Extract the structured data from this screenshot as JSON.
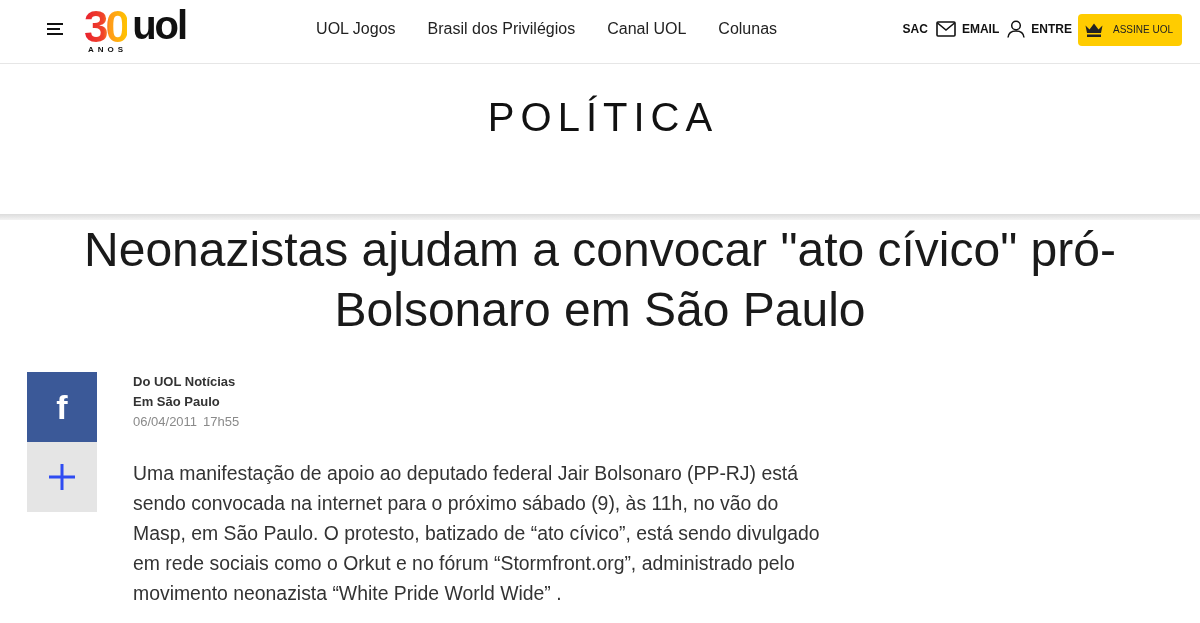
{
  "header": {
    "logo": {
      "number": "30",
      "wordmark": "uol",
      "caption": "ANOS"
    },
    "nav": [
      "UOL Jogos",
      "Brasil dos Privilégios",
      "Canal UOL",
      "Colunas"
    ],
    "utility": [
      {
        "kind": "text",
        "label": "SAC"
      },
      {
        "kind": "email",
        "label": "EMAIL"
      },
      {
        "kind": "user",
        "label": "ENTRE"
      }
    ],
    "subscribe": "ASSINE UOL"
  },
  "section": {
    "title": "POLÍTICA"
  },
  "article": {
    "headline": "Neonazistas ajudam a convocar \"ato cívico\" pró-Bolsonaro em São Paulo",
    "share": [
      {
        "kind": "letter",
        "label": "f"
      },
      {
        "kind": "plus"
      }
    ],
    "byline": {
      "source": "Do UOL Notícias",
      "location": "Em São Paulo",
      "date": "06/04/2011",
      "time": "17h55"
    },
    "paragraphs": [
      "Uma manifestação de apoio ao deputado federal Jair Bolsonaro (PP-RJ) está sendo convocada na internet para o próximo sábado (9), às 11h, no vão do Masp, em São Paulo. O protesto, batizado de “ato cívico”, está sendo divulgado em rede sociais como o Orkut e no fórum “Stormfront.org”, administrado pelo movimento neonazista “White Pride World Wide” ."
    ]
  }
}
